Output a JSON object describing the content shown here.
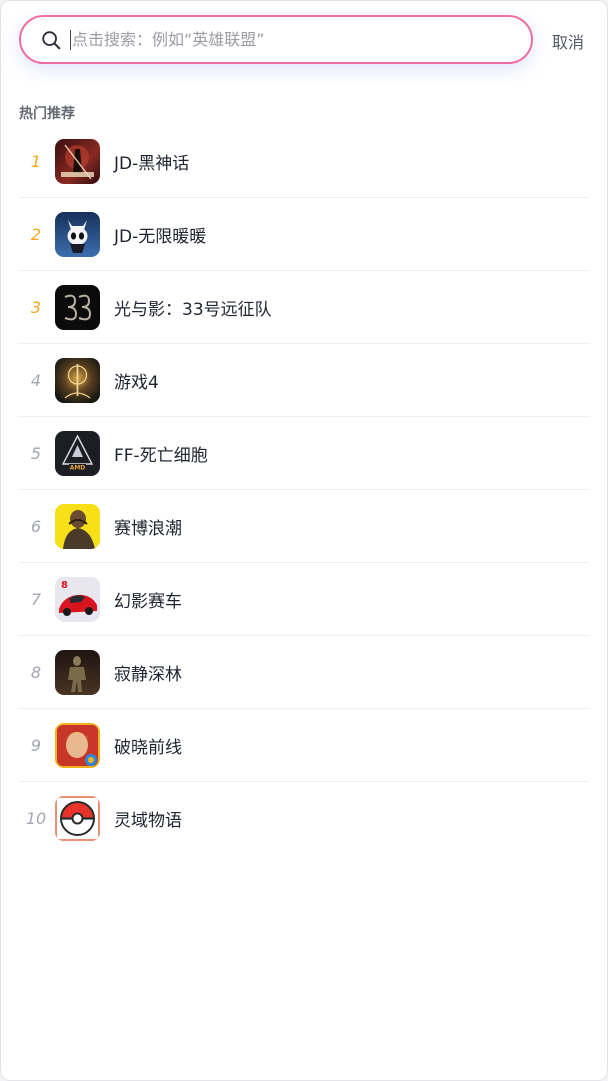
{
  "search": {
    "value": "",
    "placeholder": "点击搜索：例如“英雄联盟”",
    "cancel_label": "取消"
  },
  "section": {
    "title": "热门推荐"
  },
  "colors": {
    "search_border": "#ec6fa4",
    "top_rank": "#f0a91f",
    "rank": "#a4a7b0"
  },
  "games": [
    {
      "rank": "1",
      "name": "JD-黑神话",
      "icon": "wukong-game-icon"
    },
    {
      "rank": "2",
      "name": "JD-无限暖暖",
      "icon": "hollow-knight-game-icon"
    },
    {
      "rank": "3",
      "name": "光与影：33号远征队",
      "icon": "expedition-33-game-icon"
    },
    {
      "rank": "4",
      "name": "游戏4",
      "icon": "elden-ring-game-icon"
    },
    {
      "rank": "5",
      "name": "FF-死亡细胞",
      "icon": "amd-game-icon"
    },
    {
      "rank": "6",
      "name": "赛博浪潮",
      "icon": "soldier-game-icon"
    },
    {
      "rank": "7",
      "name": "幻影赛车",
      "icon": "race-car-game-icon"
    },
    {
      "rank": "8",
      "name": "寂静深林",
      "icon": "forest-creature-game-icon"
    },
    {
      "rank": "9",
      "name": "破晓前线",
      "icon": "hero-game-icon"
    },
    {
      "rank": "10",
      "name": "灵域物语",
      "icon": "pokeball-game-icon"
    }
  ]
}
